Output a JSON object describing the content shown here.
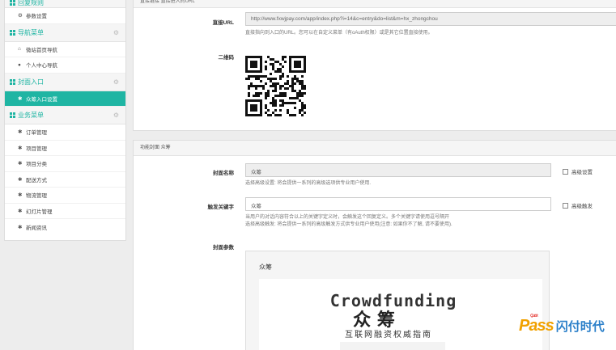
{
  "sidebar": {
    "top_group": {
      "title": "回复规则"
    },
    "top_items": [
      {
        "icon": "gear-icon",
        "label": "参数设置"
      }
    ],
    "nav_group": {
      "title": "导航菜单"
    },
    "nav_items": [
      {
        "icon": "home-icon",
        "label": "微站首页导航"
      },
      {
        "icon": "user-icon",
        "label": "个人中心导航"
      }
    ],
    "cover_group": {
      "title": "封面入口"
    },
    "cover_items": [
      {
        "icon": "puzzle-icon",
        "label": "众筹入口设置",
        "active": true
      }
    ],
    "biz_group": {
      "title": "业务菜单"
    },
    "biz_items": [
      {
        "icon": "puzzle-icon",
        "label": "订单管理"
      },
      {
        "icon": "puzzle-icon",
        "label": "项目管理"
      },
      {
        "icon": "puzzle-icon",
        "label": "项目分类"
      },
      {
        "icon": "puzzle-icon",
        "label": "配送方式"
      },
      {
        "icon": "puzzle-icon",
        "label": "物流管理"
      },
      {
        "icon": "puzzle-icon",
        "label": "幻灯片管理"
      },
      {
        "icon": "puzzle-icon",
        "label": "新闻资讯"
      }
    ]
  },
  "direct_panel": {
    "header": "直接链接 直接进入的URL",
    "url_label": "直接URL",
    "url_value": "http://www.fxwjpay.com/app/index.php?i=14&c=entry&do=list&m=hx_zhongchou",
    "url_help": "直接指向到入口的URL。您可以在自定义菜单（有oAuth权限）或是其它位置直接使用。",
    "qr_label": "二维码"
  },
  "cover_panel": {
    "header": "功能封面 众筹",
    "name_label": "封面名称",
    "name_value": "众筹",
    "name_checkbox": "高级设置",
    "name_help": "选择高级设置: 将会提供一系列的高级选项供专业用户使用.",
    "keyword_label": "触发关键字",
    "keyword_value": "众筹",
    "keyword_checkbox": "高级触发",
    "keyword_help_1": "当用户的对话内容符合以上的关键字定义时，会触发这个回复定义。多个关键字请使用逗号隔开",
    "keyword_help_2": "选择高级触发: 将会提供一系列的高级触发方式供专业用户使用(注意: 如果你不了解, 请不要使用).",
    "params_label": "封面参数",
    "preview_title": "众筹",
    "preview_image_en": "Crowdfunding",
    "preview_image_cn": "众 筹",
    "preview_image_sub": "互联网融资权威指南"
  },
  "watermark": {
    "quick": "Quick",
    "pass": "Pass",
    "cn": "闪付时代"
  },
  "colors": {
    "accent": "#1fb5a3",
    "watermark_orange": "#f1a100",
    "watermark_blue": "#2a7fc9"
  }
}
